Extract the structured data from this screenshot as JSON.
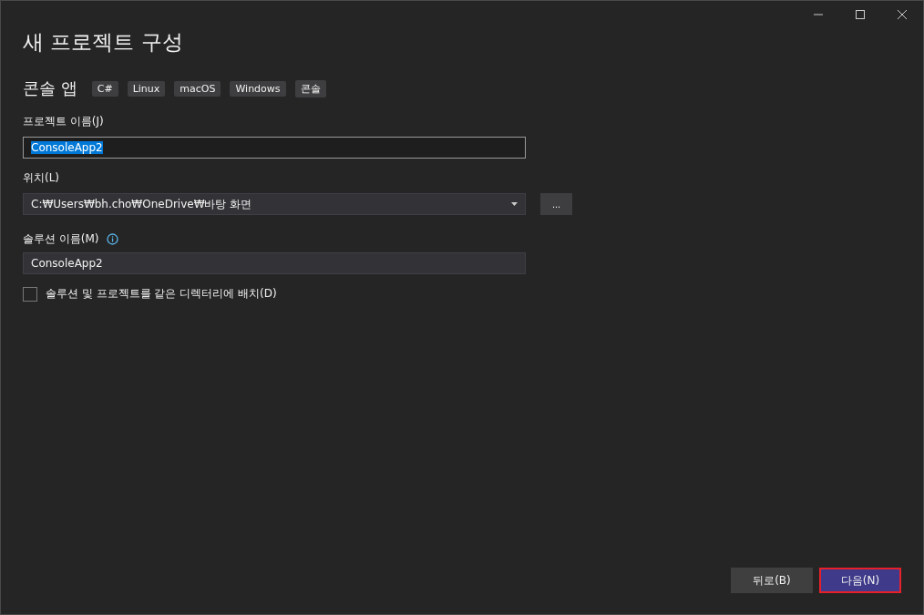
{
  "window": {
    "title": "새 프로젝트 구성"
  },
  "template": {
    "name": "콘솔 앱",
    "tags": [
      "C#",
      "Linux",
      "macOS",
      "Windows",
      "콘솔"
    ]
  },
  "project_name": {
    "label": "프로젝트 이름(J)",
    "value": "ConsoleApp2",
    "text_selected": true
  },
  "location": {
    "label": "위치(L)",
    "value": "C:₩Users₩bh.cho₩OneDrive₩바탕 화면",
    "browse_button": "..."
  },
  "solution_name": {
    "label": "솔루션 이름(M)",
    "value": "ConsoleApp2"
  },
  "same_directory": {
    "label": "솔루션 및 프로젝트를 같은 디렉터리에 배치(D)",
    "checked": false
  },
  "buttons": [
    {
      "label": "뒤로(B)",
      "kind": "secondary",
      "highlighted": false
    },
    {
      "label": "다음(N)",
      "kind": "primary",
      "highlighted": true
    }
  ]
}
